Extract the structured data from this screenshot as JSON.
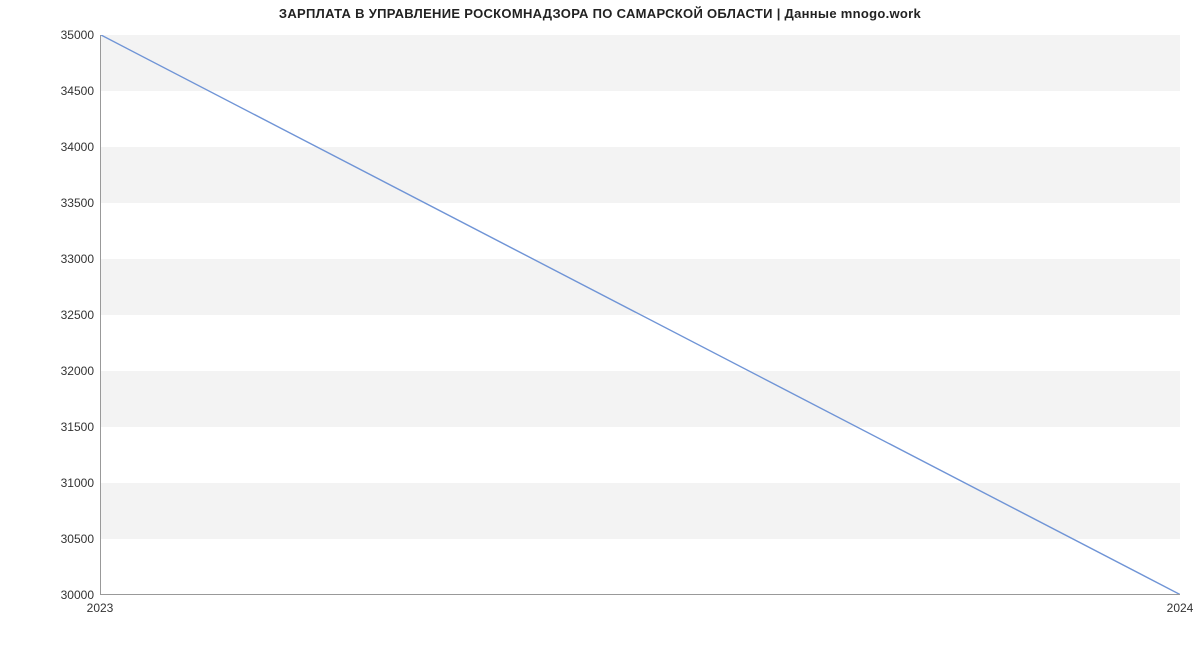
{
  "chart_data": {
    "type": "line",
    "title": "ЗАРПЛАТА В УПРАВЛЕНИЕ РОСКОМНАДЗОРА ПО САМАРСКОЙ ОБЛАСТИ | Данные mnogo.work",
    "xlabel": "",
    "ylabel": "",
    "x": [
      2023,
      2024
    ],
    "values": [
      35000,
      30000
    ],
    "ylim": [
      30000,
      35000
    ],
    "yticks": [
      30000,
      30500,
      31000,
      31500,
      32000,
      32500,
      33000,
      33500,
      34000,
      34500,
      35000
    ],
    "xticks": [
      2023,
      2024
    ],
    "line_color": "#6f94d6",
    "grid_bands": true
  }
}
